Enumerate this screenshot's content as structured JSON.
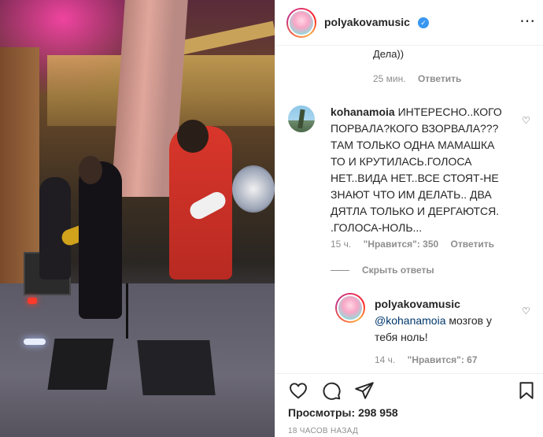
{
  "post": {
    "username": "polyakovamusic",
    "views_label": "Просмотры:",
    "views_count": "298 958",
    "timestamp": "18 часов назад"
  },
  "comments": {
    "fragment": {
      "tail_text": "Дела))",
      "age": "25 мин.",
      "reply_label": "Ответить"
    },
    "main": {
      "username": "kohanamoia",
      "text": "ИНТЕРЕСНО..КОГО ПОРВАЛА?КОГО ВЗОРВАЛА??? ТАМ ТОЛЬКО ОДНА МАМАШКА ТО И КРУТИЛАСЬ.ГОЛОСА НЕТ..ВИДА НЕТ..ВСЕ СТОЯТ-НЕ ЗНАЮТ ЧТО ИМ ДЕЛАТЬ.. ДВА ДЯТЛА ТОЛЬКО И ДЕРГАЮТСЯ. .ГОЛОСА-НОЛЬ...",
      "age": "15 ч.",
      "likes_label": "\"Нравится\": 350",
      "reply_label": "Ответить"
    },
    "hide_replies": "Скрыть ответы",
    "reply": {
      "username": "polyakovamusic",
      "mention": "@kohanamoia",
      "text": " мозгов у тебя ноль!",
      "age": "14 ч.",
      "likes_label": "\"Нравится\": 67"
    }
  },
  "actions": {
    "like_icon": "heart-outline-icon",
    "comment_icon": "comment-icon",
    "share_icon": "paper-plane-icon",
    "save_icon": "bookmark-icon"
  },
  "colors": {
    "verified": "#3897f0",
    "text": "#262626",
    "muted": "#8e8e8e",
    "mention": "#00376b"
  }
}
